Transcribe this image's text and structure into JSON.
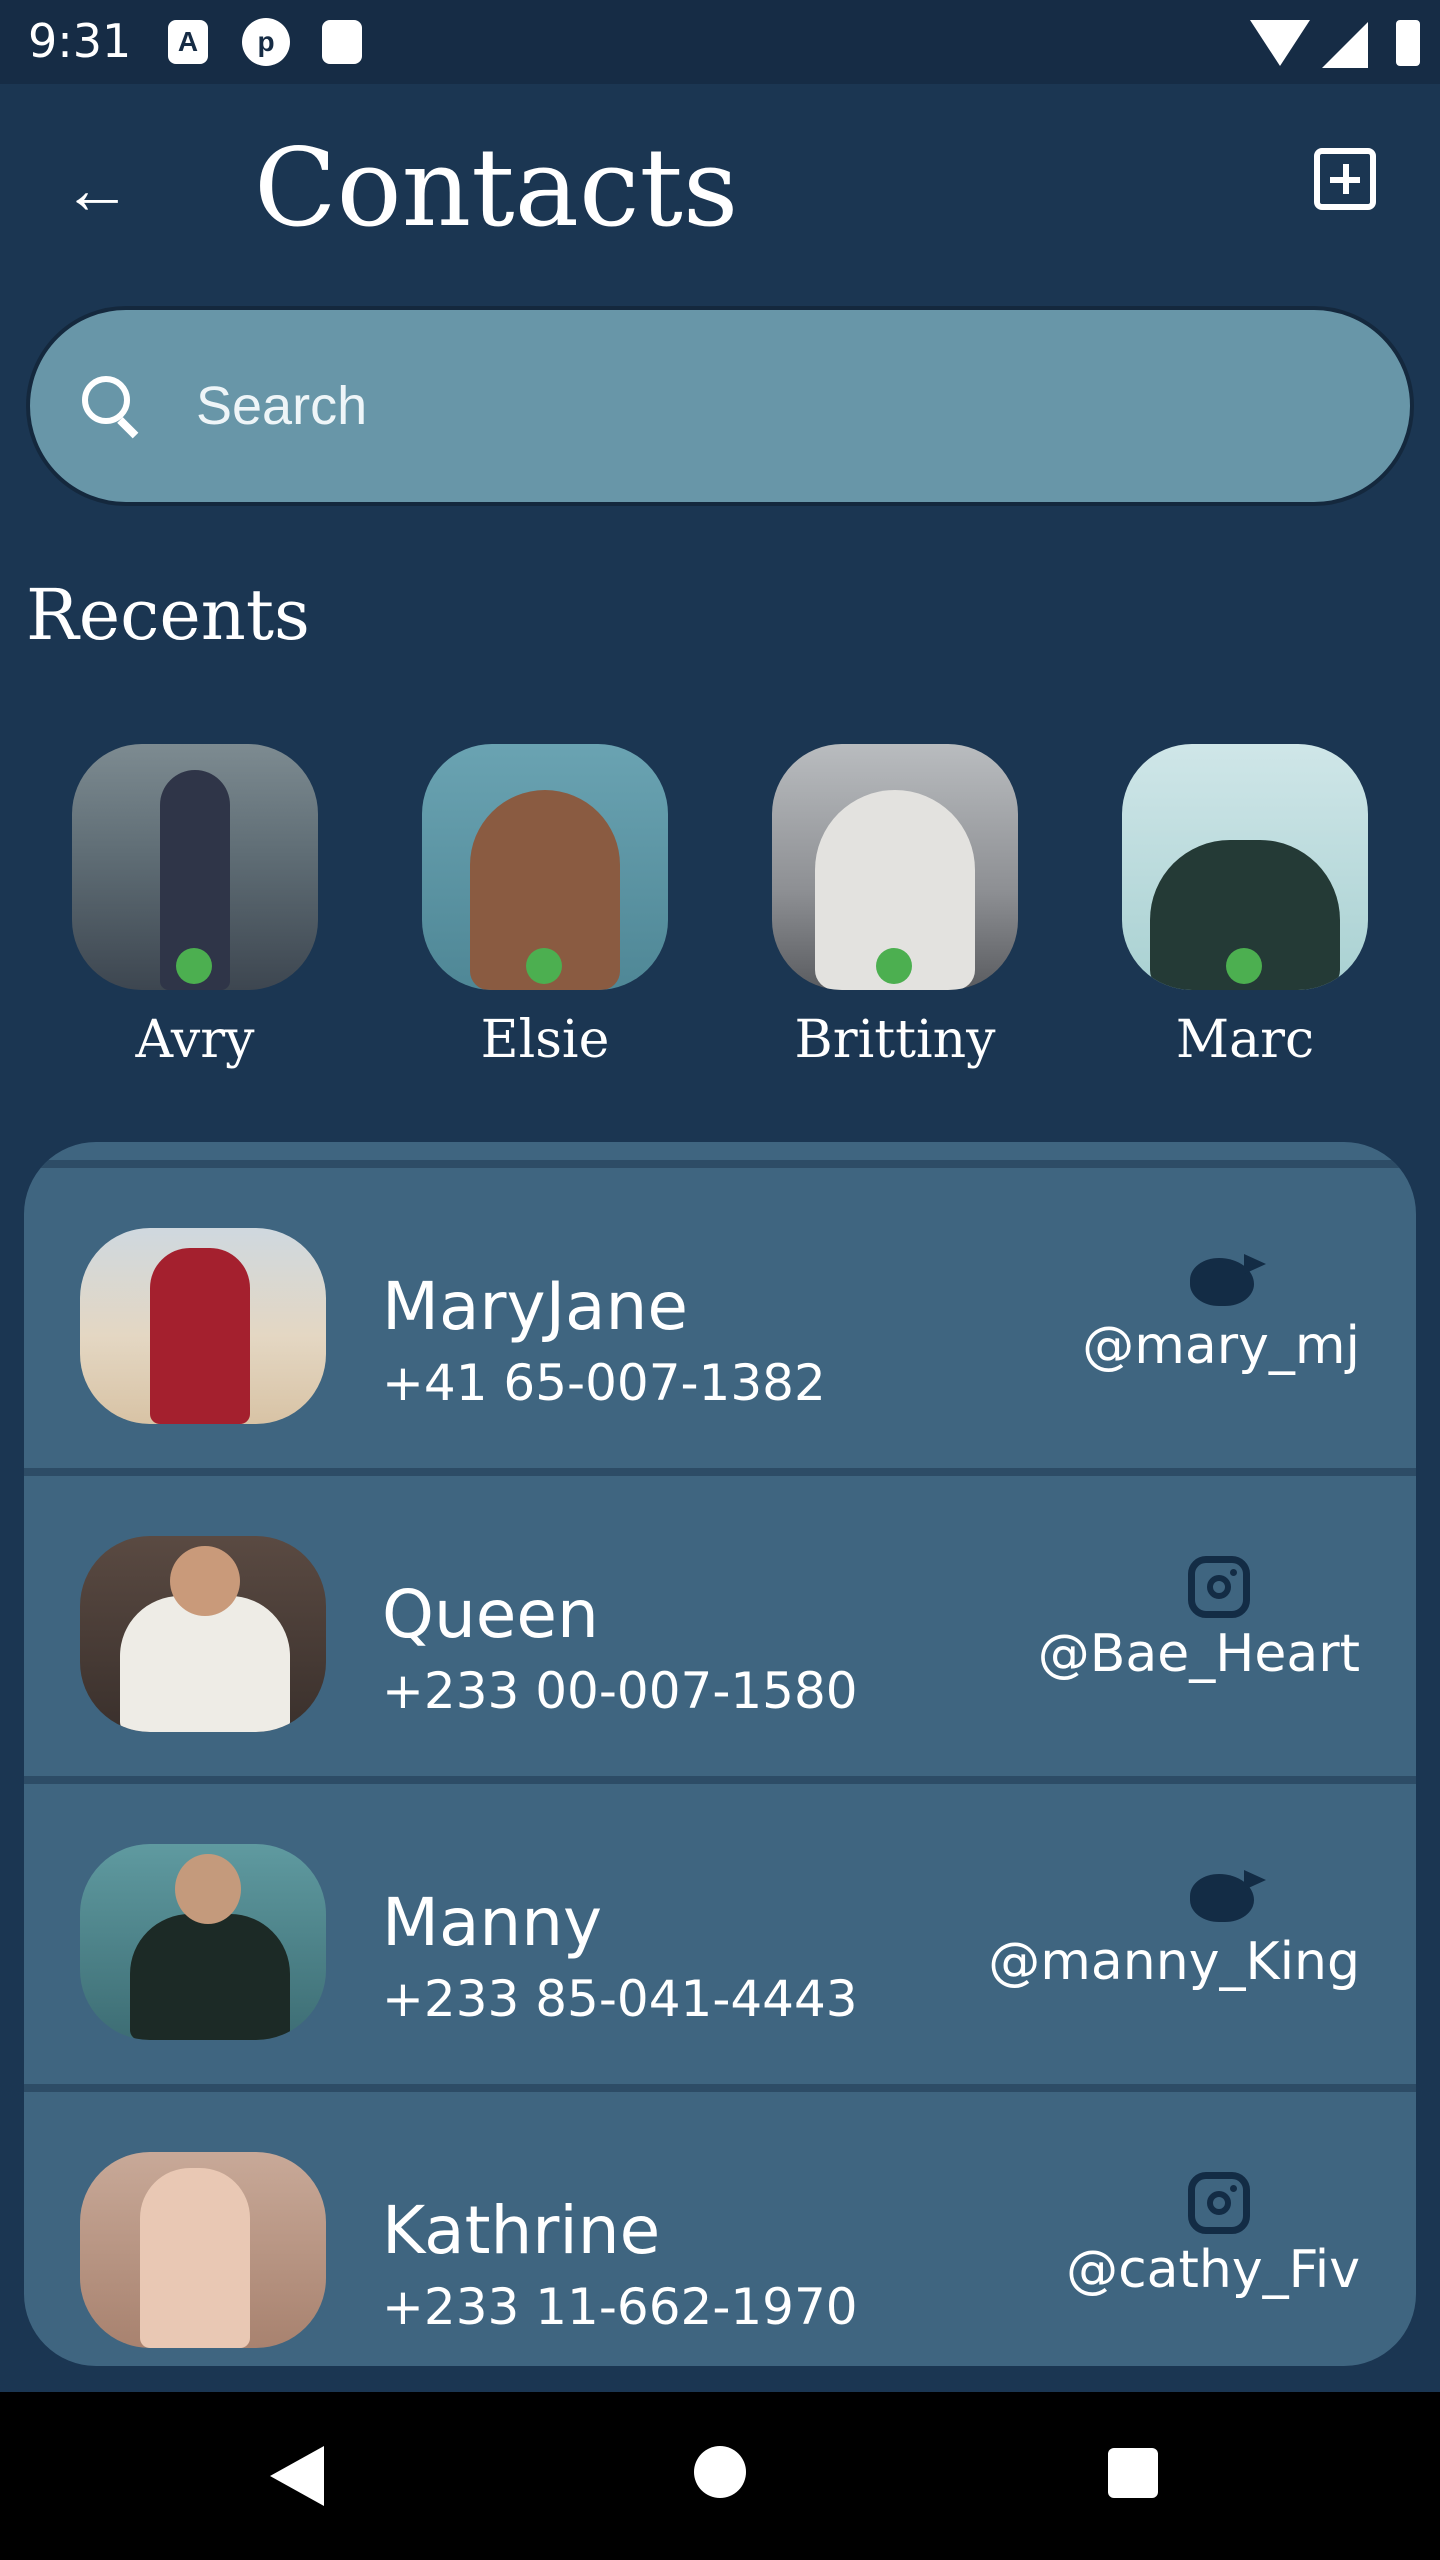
{
  "status_bar": {
    "time": "9:31",
    "icons": [
      "a-icon",
      "p-icon",
      "sd-card-icon",
      "wifi-icon",
      "signal-icon",
      "battery-icon"
    ]
  },
  "app_bar": {
    "title": "Contacts",
    "back_icon": "arrow-back-icon",
    "add_icon": "add-box-icon"
  },
  "search": {
    "placeholder": "Search",
    "value": ""
  },
  "recents": {
    "title": "Recents",
    "items": [
      {
        "name": "Avry",
        "online": true
      },
      {
        "name": "Elsie",
        "online": true
      },
      {
        "name": "Brittiny",
        "online": true
      },
      {
        "name": "Marc",
        "online": true
      }
    ]
  },
  "contacts": [
    {
      "name": "MaryJane",
      "phone": "+41 65-007-1382",
      "social": "twitter",
      "handle": "@mary_mj"
    },
    {
      "name": "Queen",
      "phone": "+233 00-007-1580",
      "social": "instagram",
      "handle": "@Bae_Heart"
    },
    {
      "name": "Manny",
      "phone": "+233 85-041-4443",
      "social": "twitter",
      "handle": "@manny_King"
    },
    {
      "name": "Kathrine",
      "phone": "+233 11-662-1970",
      "social": "instagram",
      "handle": "@cathy_Fiv"
    }
  ],
  "colors": {
    "background": "#1b3652",
    "search_background": "#6896a8",
    "panel": "#3f6580",
    "online": "#4caf50"
  }
}
